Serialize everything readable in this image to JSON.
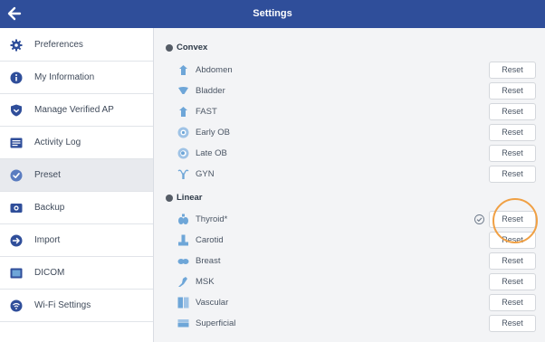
{
  "header": {
    "title": "Settings",
    "back_icon": "arrow-left-icon"
  },
  "sidebar": {
    "items": [
      {
        "label": "Preferences",
        "icon": "gear-icon"
      },
      {
        "label": "My Information",
        "icon": "info-icon"
      },
      {
        "label": "Manage Verified AP",
        "icon": "shield-icon"
      },
      {
        "label": "Activity Log",
        "icon": "log-icon"
      },
      {
        "label": "Preset",
        "icon": "checkmark-circle-icon",
        "active": true
      },
      {
        "label": "Backup",
        "icon": "backup-icon"
      },
      {
        "label": "Import",
        "icon": "import-icon"
      },
      {
        "label": "DICOM",
        "icon": "dicom-icon"
      },
      {
        "label": "Wi-Fi Settings",
        "icon": "wifi-icon"
      }
    ]
  },
  "sections": [
    {
      "title": "Convex",
      "presets": [
        {
          "label": "Abdomen",
          "icon": "abdomen-icon",
          "button": "Reset"
        },
        {
          "label": "Bladder",
          "icon": "bladder-icon",
          "button": "Reset"
        },
        {
          "label": "FAST",
          "icon": "fast-icon",
          "button": "Reset"
        },
        {
          "label": "Early OB",
          "icon": "early-ob-icon",
          "button": "Reset"
        },
        {
          "label": "Late OB",
          "icon": "late-ob-icon",
          "button": "Reset"
        },
        {
          "label": "GYN",
          "icon": "gyn-icon",
          "button": "Reset"
        }
      ]
    },
    {
      "title": "Linear",
      "presets": [
        {
          "label": "Thyroid*",
          "icon": "thyroid-icon",
          "button": "Reset",
          "checked": true
        },
        {
          "label": "Carotid",
          "icon": "carotid-icon",
          "button": "Reset"
        },
        {
          "label": "Breast",
          "icon": "breast-icon",
          "button": "Reset"
        },
        {
          "label": "MSK",
          "icon": "msk-icon",
          "button": "Reset"
        },
        {
          "label": "Vascular",
          "icon": "vascular-icon",
          "button": "Reset"
        },
        {
          "label": "Superficial",
          "icon": "superficial-icon",
          "button": "Reset"
        }
      ]
    }
  ],
  "colors": {
    "header_bg": "#2f4e9a",
    "accent": "#2f4e9a",
    "icon_blue": "#6ea6d8",
    "highlight": "#f0a044"
  }
}
